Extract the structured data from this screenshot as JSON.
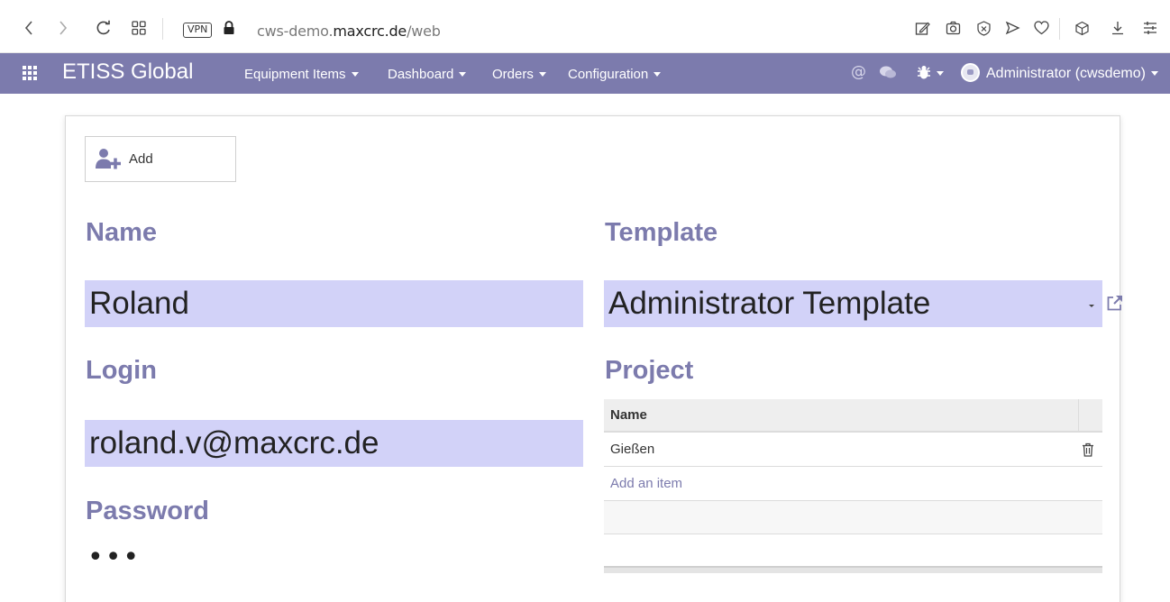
{
  "browser": {
    "vpn_label": "VPN",
    "url_prefix": "cws-demo.",
    "url_domain": "maxcrc.de",
    "url_path": "/web"
  },
  "nav": {
    "brand": "ETISS Global",
    "menus": [
      "Equipment Items",
      "Dashboard",
      "Orders",
      "Configuration"
    ],
    "user": "Administrator (cwsdemo)"
  },
  "form": {
    "add_button": "Add",
    "name_label": "Name",
    "name_value": "Roland",
    "login_label": "Login",
    "login_value": "roland.v@maxcrc.de",
    "password_label": "Password",
    "password_value": "•••",
    "template_label": "Template",
    "template_value": "Administrator Template",
    "project_label": "Project"
  },
  "project_table": {
    "header_name": "Name",
    "rows": [
      {
        "name": "Gießen"
      }
    ],
    "add_item": "Add an item"
  },
  "colors": {
    "accent": "#7c7bad",
    "input_bg": "#d2d2f8"
  }
}
